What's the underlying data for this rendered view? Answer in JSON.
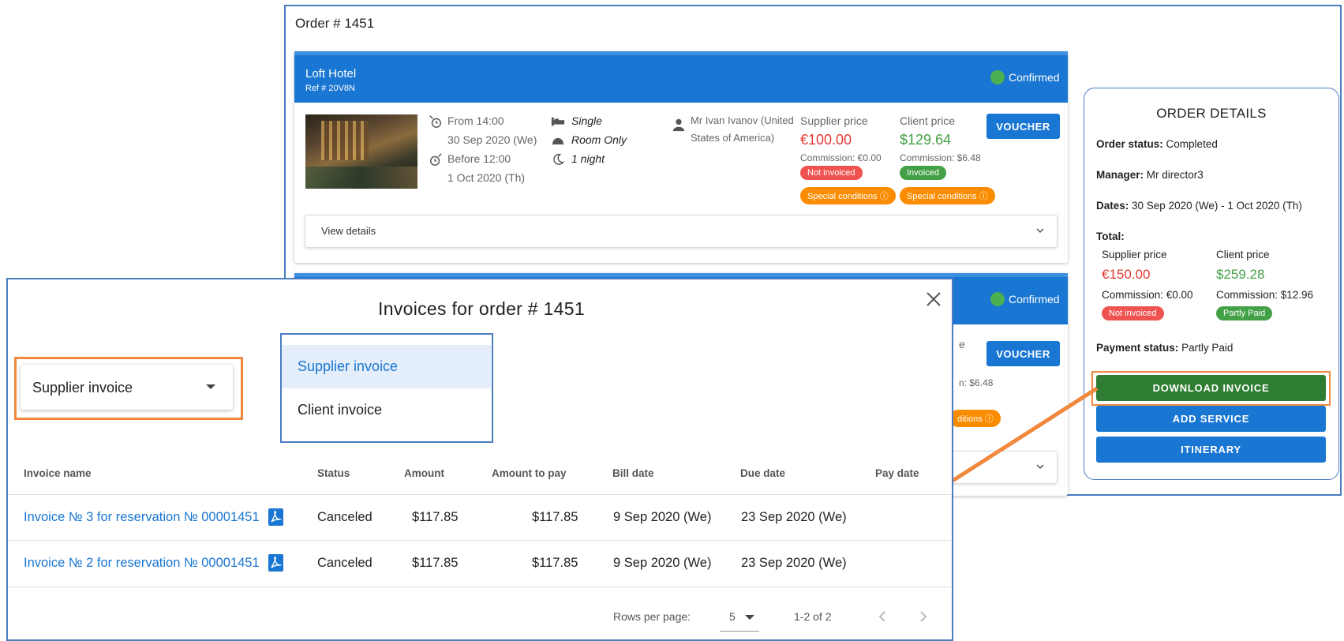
{
  "order": {
    "title": "Order # 1451",
    "cards": [
      {
        "hotel": "Loft Hotel",
        "ref": "Ref # 20V8N",
        "status": "Confirmed",
        "from": "From 14:00",
        "from_date": "30 Sep 2020 (We)",
        "before": "Before 12:00",
        "before_date": "1 Oct 2020 (Th)",
        "room": "Single",
        "board": "Room Only",
        "nights": "1 night",
        "guest": "Mr Ivan Ivanov (United",
        "guest_2": "States of America)",
        "supplier_label": "Supplier price",
        "supplier_price": "€100.00",
        "supplier_commission": "Commission: €0.00",
        "supplier_badge": "Not invoiced",
        "supplier_conditions": "Special conditions ⓘ",
        "client_label": "Client price",
        "client_price": "$129.64",
        "client_commission": "Commission: $6.48",
        "client_badge": "Invoiced",
        "client_conditions": "Special conditions ⓘ",
        "voucher": "VOUCHER",
        "view_details": "View details"
      },
      {
        "status": "Confirmed",
        "voucher": "VOUCHER",
        "partial_text": "e",
        "partial_commission": "n: $6.48",
        "partial_conditions": "ditions ⓘ"
      }
    ]
  },
  "details": {
    "heading": "ORDER DETAILS",
    "status_label": "Order status:",
    "status_value": "Completed",
    "manager_label": "Manager:",
    "manager_value": "Mr director3",
    "dates_label": "Dates:",
    "dates_value": "30 Sep 2020 (We) - 1 Oct 2020 (Th)",
    "total_label": "Total:",
    "supplier_label": "Supplier price",
    "supplier_price": "€150.00",
    "supplier_commission": "Commission: €0.00",
    "supplier_badge": "Not invoiced",
    "client_label": "Client price",
    "client_price": "$259.28",
    "client_commission": "Commission: $12.96",
    "client_badge": "Partly Paid",
    "payment_label": "Payment status:",
    "payment_value": "Partly Paid",
    "download": "DOWNLOAD INVOICE",
    "add_service": "ADD SERVICE",
    "itinerary": "ITINERARY"
  },
  "modal": {
    "title": "Invoices for order # 1451",
    "select_value": "Supplier invoice",
    "options": [
      "Supplier invoice",
      "Client invoice"
    ],
    "columns": [
      "Invoice name",
      "Status",
      "Amount",
      "Amount to pay",
      "Bill date",
      "Due date",
      "Pay date"
    ],
    "rows": [
      [
        "Invoice № 3 for reservation № 00001451",
        "Canceled",
        "$117.85",
        "$117.85",
        "9 Sep 2020 (We)",
        "23 Sep 2020 (We)",
        ""
      ],
      [
        "Invoice № 2 for reservation № 00001451",
        "Canceled",
        "$117.85",
        "$117.85",
        "9 Sep 2020 (We)",
        "23 Sep 2020 (We)",
        ""
      ]
    ],
    "rows_per_page_label": "Rows per page:",
    "rows_per_page": "5",
    "range": "1-2 of 2"
  },
  "colors": {
    "primary": "#1976d2",
    "success": "#2e7d32",
    "danger": "#e53935",
    "highlight": "#f0883e",
    "frame": "#4a7cc0"
  }
}
